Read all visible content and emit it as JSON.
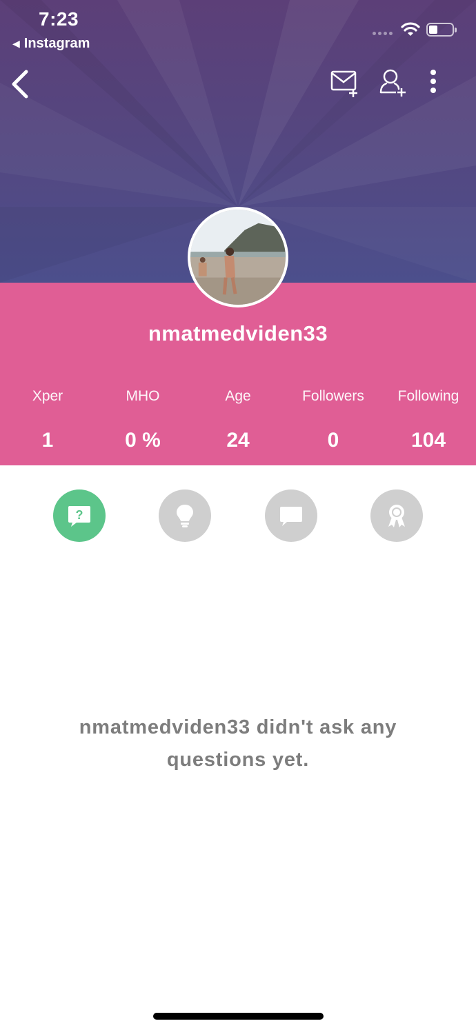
{
  "status_bar": {
    "time": "7:23",
    "back_app_label": "Instagram"
  },
  "nav": {
    "back_icon": "chevron-left-icon",
    "actions": [
      {
        "name": "message-add-icon"
      },
      {
        "name": "user-add-icon"
      },
      {
        "name": "more-vertical-icon"
      }
    ]
  },
  "profile": {
    "username": "nmatmedviden33",
    "stats": [
      {
        "label": "Xper",
        "value": "1"
      },
      {
        "label": "MHO",
        "value": "0 %"
      },
      {
        "label": "Age",
        "value": "24"
      },
      {
        "label": "Followers",
        "value": "0"
      },
      {
        "label": "Following",
        "value": "104"
      }
    ]
  },
  "tabs": [
    {
      "name": "questions-tab",
      "icon": "question-bubble-icon",
      "active": true
    },
    {
      "name": "opinions-tab",
      "icon": "lightbulb-icon",
      "active": false
    },
    {
      "name": "comments-tab",
      "icon": "chat-bubble-icon",
      "active": false
    },
    {
      "name": "achievements-tab",
      "icon": "award-ribbon-icon",
      "active": false
    }
  ],
  "empty_state": {
    "message": "nmatmedviden33 didn't ask any questions yet."
  },
  "colors": {
    "header_top": "#5c3f78",
    "header_bottom": "#4c4f8c",
    "pink": "#e05e95",
    "active_tab": "#5cc58a",
    "inactive_tab": "#cfcfcf",
    "empty_text": "#7d7d7d"
  }
}
